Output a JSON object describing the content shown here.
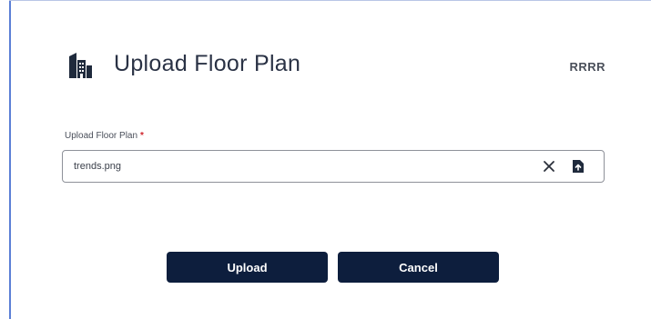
{
  "dialog": {
    "title": "Upload Floor Plan",
    "header_icon": "building-icon",
    "header_right_text": "RRRR"
  },
  "form": {
    "field_label": "Upload Floor Plan",
    "required_marker": "*",
    "file_value": "trends.png",
    "clear_icon": "close-icon",
    "save_icon": "file-save-icon"
  },
  "actions": {
    "upload_label": "Upload",
    "cancel_label": "Cancel"
  },
  "colors": {
    "button_bg": "#0d1e3d",
    "button_text": "#ffffff",
    "required": "#d0262d",
    "accent_border": "#5b7fd6"
  }
}
